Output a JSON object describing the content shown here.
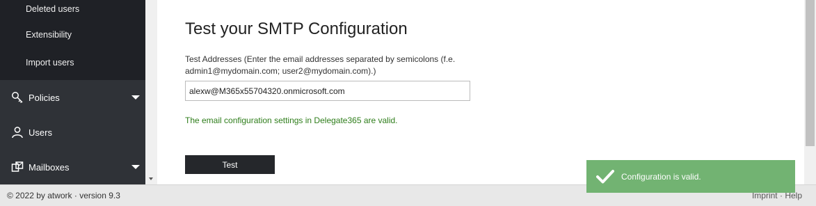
{
  "sidebar": {
    "sub_items": [
      {
        "label": "Deleted users"
      },
      {
        "label": "Extensibility"
      },
      {
        "label": "Import users"
      }
    ],
    "items": [
      {
        "label": "Policies",
        "icon": "key-icon",
        "expandable": true
      },
      {
        "label": "Users",
        "icon": "user-icon",
        "expandable": false
      },
      {
        "label": "Mailboxes",
        "icon": "mailbox-icon",
        "expandable": true
      }
    ]
  },
  "main": {
    "title": "Test your SMTP Configuration",
    "field_label": "Test Addresses (Enter the email addresses separated by semicolons (f.e. admin1@mydomain.com; user2@mydomain.com).)",
    "field_value": "alexw@M365x55704320.onmicrosoft.com",
    "success_message": "The email configuration settings in Delegate365 are valid.",
    "test_button": "Test"
  },
  "footer": {
    "copyright": "© 2022 by atwork · version 9.3",
    "imprint": "Imprint",
    "separator": "·",
    "help": "Help"
  },
  "toast": {
    "message": "Configuration is valid.",
    "color": "#72b372"
  }
}
